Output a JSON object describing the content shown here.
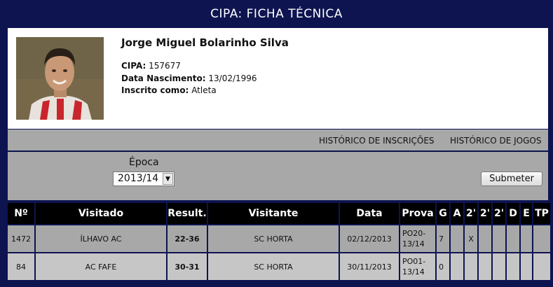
{
  "header": {
    "title": "CIPA: FICHA TÉCNICA"
  },
  "profile": {
    "name": "Jorge Miguel Bolarinho Silva",
    "cipa_label": "CIPA:",
    "cipa_value": "157677",
    "birth_label": "Data Nascimento:",
    "birth_value": "13/02/1996",
    "registered_label": "Inscrito como:",
    "registered_value": "Atleta"
  },
  "links": {
    "inscricoes": "HISTÓRICO DE INSCRIÇÕES",
    "jogos": "HISTÓRICO DE JOGOS"
  },
  "filter": {
    "label": "Época",
    "selected": "2013/14",
    "submit": "Submeter"
  },
  "table": {
    "headers": [
      "Nº",
      "Visitado",
      "Result.",
      "Visitante",
      "Data",
      "Prova",
      "G",
      "A",
      "2'",
      "2'",
      "2'",
      "D",
      "E",
      "TP"
    ],
    "rows": [
      {
        "num": "1472",
        "home": "ÍLHAVO AC",
        "res_a": "22-",
        "res_b": "36",
        "away": "SC HORTA",
        "date": "02/12/2013",
        "prova_1": "PO20-",
        "prova_2": "13/14",
        "g": "7",
        "a": "",
        "m1": "X",
        "m2": "",
        "m3": "",
        "d": "",
        "e": "",
        "tp": ""
      },
      {
        "num": "84",
        "home": "AC FAFE",
        "res_a": "30-",
        "res_b": "31",
        "away": "SC HORTA",
        "date": "30/11/2013",
        "prova_1": "PO01-",
        "prova_2": "13/14",
        "g": "0",
        "a": "",
        "m1": "",
        "m2": "",
        "m3": "",
        "d": "",
        "e": "",
        "tp": ""
      }
    ]
  }
}
